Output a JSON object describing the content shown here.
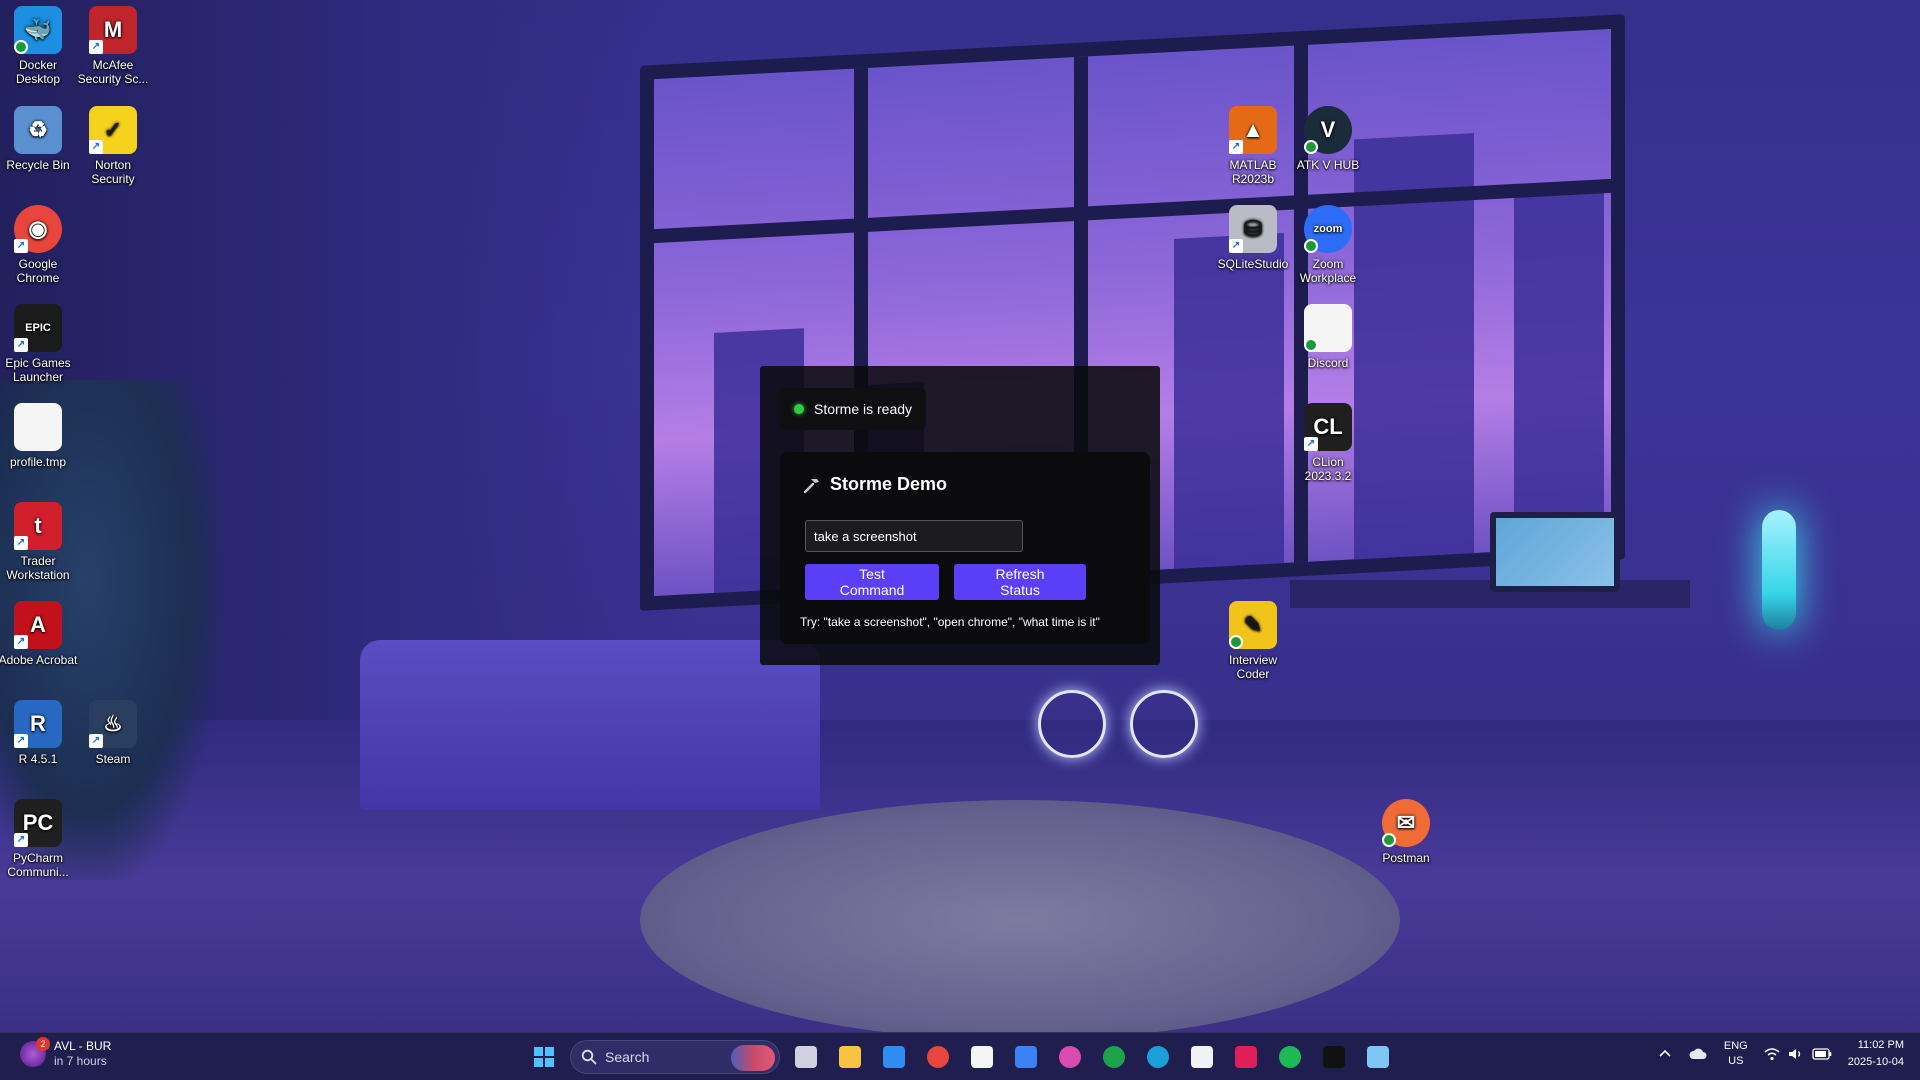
{
  "desktop_icons": [
    {
      "id": "docker",
      "label": "Docker Desktop",
      "glyph": "🐳",
      "color": "#1d8fe2",
      "badge": "sync"
    },
    {
      "id": "mcafee",
      "label": "McAfee Security Sc...",
      "glyph": "M",
      "color": "#c0252b",
      "badge": "shortcut"
    },
    {
      "id": "recycle",
      "label": "Recycle Bin",
      "glyph": "♻",
      "color": "#5a8fd0",
      "badge": "none"
    },
    {
      "id": "norton",
      "label": "Norton Security",
      "glyph": "✓",
      "color": "#f5d21b",
      "badge": "shortcut"
    },
    {
      "id": "chrome",
      "label": "Google Chrome",
      "glyph": "◉",
      "color": "#e8453c",
      "badge": "shortcut"
    },
    {
      "id": "epic",
      "label": "Epic Games Launcher",
      "glyph": "EPIC",
      "color": "#1b1b1b",
      "badge": "shortcut"
    },
    {
      "id": "profile",
      "label": "profile.tmp",
      "glyph": "",
      "color": "#f5f5f5",
      "badge": "none"
    },
    {
      "id": "trader",
      "label": "Trader Workstation",
      "glyph": "t",
      "color": "#d11f2b",
      "badge": "shortcut"
    },
    {
      "id": "acrobat",
      "label": "Adobe Acrobat",
      "glyph": "A",
      "color": "#c3111b",
      "badge": "shortcut"
    },
    {
      "id": "r",
      "label": "R 4.5.1",
      "glyph": "R",
      "color": "#2769c2",
      "badge": "shortcut"
    },
    {
      "id": "steam",
      "label": "Steam",
      "glyph": "♨",
      "color": "#2a3f5f",
      "badge": "shortcut"
    },
    {
      "id": "pycharm",
      "label": "PyCharm Communi...",
      "glyph": "PC",
      "color": "#1f1f1f",
      "badge": "shortcut"
    },
    {
      "id": "matlab",
      "label": "MATLAB R2023b",
      "glyph": "▲",
      "color": "#e56a16",
      "badge": "shortcut"
    },
    {
      "id": "atkv",
      "label": "ATK V HUB",
      "glyph": "V",
      "color": "#1a2b3a",
      "badge": "sync"
    },
    {
      "id": "sqlite",
      "label": "SQLiteStudio",
      "glyph": "⛁",
      "color": "#b9bcc4",
      "badge": "shortcut"
    },
    {
      "id": "zoom",
      "label": "Zoom Workplace",
      "glyph": "zoom",
      "color": "#2d6cf6",
      "badge": "sync"
    },
    {
      "id": "discord",
      "label": "Discord",
      "glyph": "",
      "color": "#f5f5f5",
      "badge": "sync"
    },
    {
      "id": "clion",
      "label": "CLion 2023.3.2",
      "glyph": "CL",
      "color": "#1f1f1f",
      "badge": "shortcut"
    },
    {
      "id": "interview",
      "label": "Interview Coder",
      "glyph": "✎",
      "color": "#f0c419",
      "badge": "sync"
    },
    {
      "id": "postman",
      "label": "Postman",
      "glyph": "✉",
      "color": "#ef6c37",
      "badge": "sync"
    }
  ],
  "storme": {
    "status_text": "Storme is ready",
    "title": "Storme Demo",
    "command_value": "take a screenshot",
    "test_button": "Test Command",
    "refresh_button": "Refresh Status",
    "hint": "Try: \"take a screenshot\", \"open chrome\", \"what time is it\""
  },
  "taskbar": {
    "weather_title": "AVL - BUR",
    "weather_sub": "in 7 hours",
    "weather_badge": "2",
    "search_placeholder": "Search",
    "pinned": [
      "windows-start",
      "task-view",
      "file-explorer",
      "microsoft-store",
      "chrome",
      "notion",
      "unknown-app",
      "instagram",
      "xbox",
      "edge",
      "notepad",
      "slack",
      "spotify",
      "terminal-app",
      "notepad-plus"
    ],
    "lang_top": "ENG",
    "lang_bottom": "US",
    "time": "11:02 PM",
    "date": "2025-10-04"
  }
}
